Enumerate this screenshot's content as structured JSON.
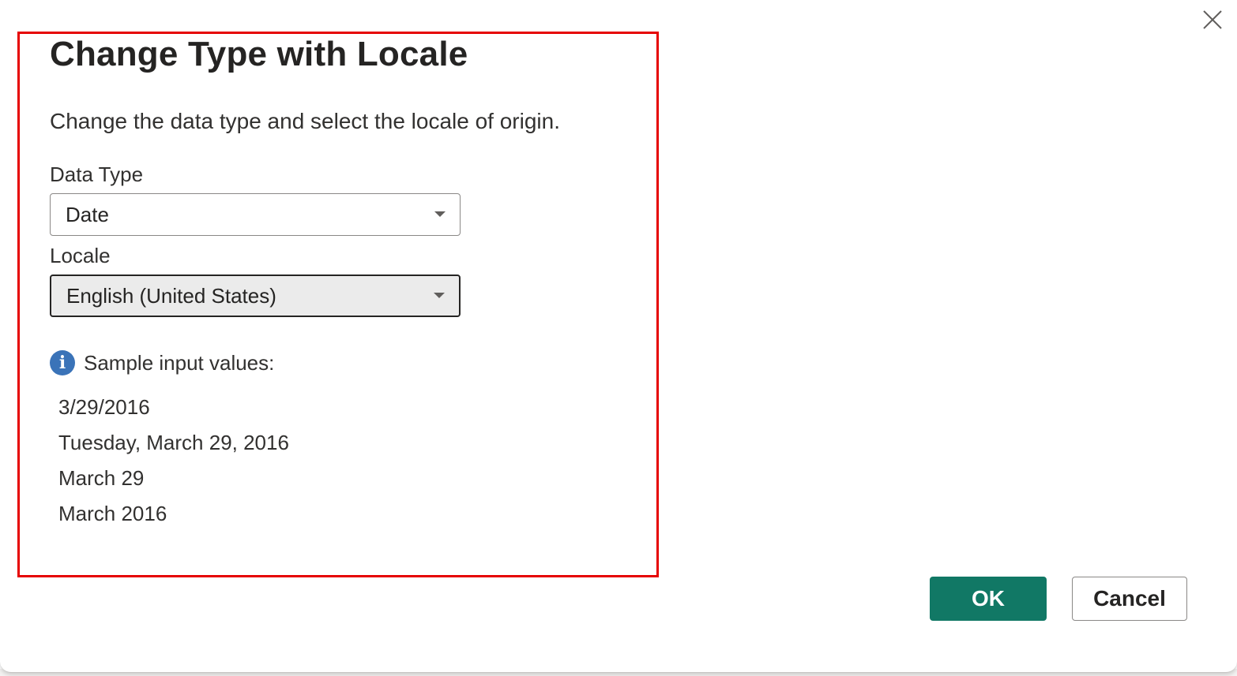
{
  "dialog": {
    "title": "Change Type with Locale",
    "description": "Change the data type and select the locale of origin.",
    "close_icon": "close-icon"
  },
  "data_type": {
    "label": "Data Type",
    "selected": "Date"
  },
  "locale": {
    "label": "Locale",
    "selected": "English (United States)"
  },
  "samples": {
    "icon": "info-icon",
    "heading": "Sample input values:",
    "values": [
      "3/29/2016",
      "Tuesday, March 29, 2016",
      "March 29",
      "March 2016"
    ]
  },
  "buttons": {
    "ok": "OK",
    "cancel": "Cancel"
  },
  "colors": {
    "accent": "#117865",
    "highlight": "#e60000",
    "info": "#3a73b8"
  }
}
